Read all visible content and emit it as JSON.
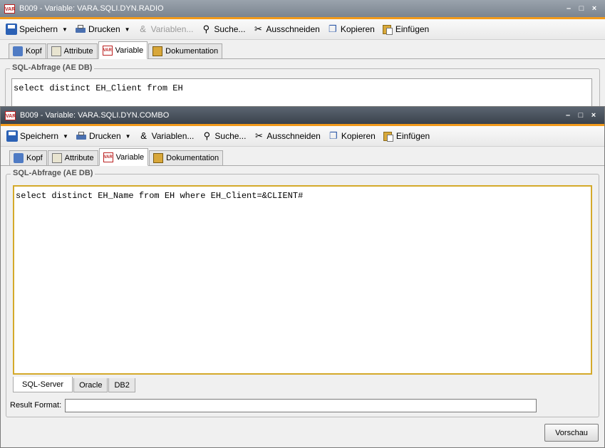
{
  "back_window": {
    "title": "B009 - Variable: VARA.SQLI.DYN.RADIO",
    "sql": "select distinct EH_Client from EH"
  },
  "front_window": {
    "title": "B009 - Variable: VARA.SQLI.DYN.COMBO",
    "sql": "select distinct EH_Name from EH where EH_Client=&CLIENT#"
  },
  "app_icon_text": "VAR",
  "window_buttons": {
    "minimize": "–",
    "maximize": "□",
    "close": "×"
  },
  "toolbar": {
    "save": "Speichern",
    "print": "Drucken",
    "variables": "Variablen...",
    "search": "Suche...",
    "cut": "Ausschneiden",
    "copy": "Kopieren",
    "paste": "Einfügen"
  },
  "tabs": {
    "kopf": "Kopf",
    "attribute": "Attribute",
    "variable": "Variable",
    "dokumentation": "Dokumentation"
  },
  "fieldset_legend": "SQL-Abfrage (AE DB)",
  "db_tabs": [
    "SQL-Server",
    "Oracle",
    "DB2"
  ],
  "result_format": {
    "label": "Result Format:",
    "value": ""
  },
  "preview_button": "Vorschau",
  "colors": {
    "accent": "#f29a1b",
    "titlebar_active": "#3a424c",
    "titlebar_inactive": "#7b848f",
    "sql_border_focus": "#d4a92a"
  }
}
